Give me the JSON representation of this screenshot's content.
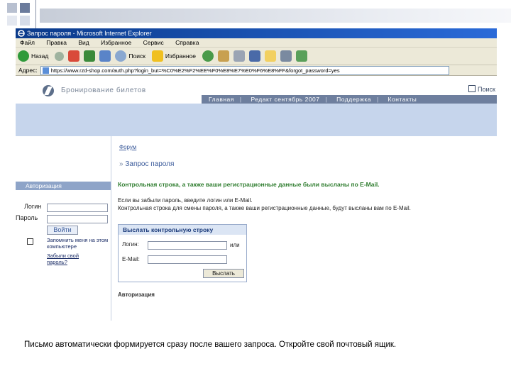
{
  "window_title": "Запрос пароля - Microsoft Internet Explorer",
  "menu": [
    "Файл",
    "Правка",
    "Вид",
    "Избранное",
    "Сервис",
    "Справка"
  ],
  "toolbar": {
    "back": "Назад",
    "search": "Поиск",
    "favorites": "Избранное"
  },
  "address": {
    "label": "Адрес:",
    "url": "https://www.rzd-shop.com/auth.php?login_but=%C0%E2%F2%EE%F0%E8%E7%E0%F6%E8%FF&forgot_password=yes"
  },
  "site": {
    "logo_text": "Бронирование билетов",
    "search_link": "Поиск",
    "nav": [
      "Главная",
      "Редакт сентябрь 2007",
      "Поддержка",
      "Контакты"
    ]
  },
  "left": {
    "auth_title": "Авторизация",
    "login_label": "Логин",
    "password_label": "Пароль",
    "login_button": "Войти",
    "remember": "Запомнить меня на этом компьютере",
    "forgot": "Забыли свой пароль?"
  },
  "main": {
    "crumb": "Форум",
    "title_prefix": "»",
    "title": "Запрос пароля",
    "success": "Контрольная строка, а также ваши регистрационные данные были высланы по E-Mail.",
    "info1": "Если вы забыли пароль, введите логин или E-Mail.",
    "info2": "Контрольная строка для смены пароля, а также ваши регистрационные данные, будут высланы вам по E-Mail.",
    "form_title": "Выслать контрольную строку",
    "login_label": "Логин:",
    "or_text": "или",
    "email_label": "E-Mail:",
    "send_button": "Выслать",
    "auth_heading": "Авторизация"
  },
  "caption": "Письмо автоматически формируется сразу после вашего запроса. Откройте свой почтовый ящик.",
  "colors": {
    "success": "#2f7d2f",
    "nav": "#6e7f9e",
    "band": "#c6d5ec",
    "title_blue": "#3a5a9a"
  }
}
